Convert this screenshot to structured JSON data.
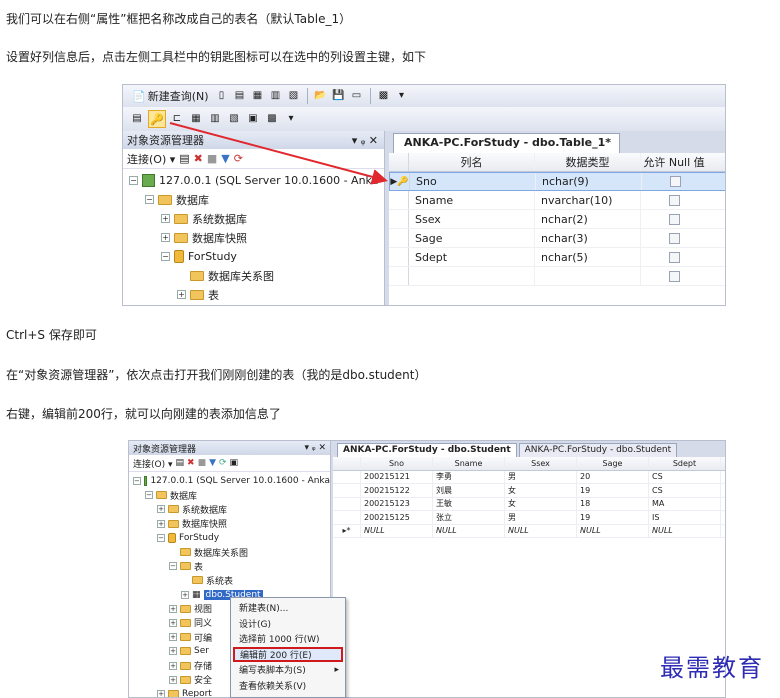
{
  "article": {
    "p1": "我们可以在右侧“属性”框把名称改成自己的表名（默认Table_1）",
    "p2": "设置好列信息后，点击左侧工具栏中的钥匙图标可以在选中的列设置主键，如下",
    "p3": "Ctrl+S 保存即可",
    "p4": "在“对象资源管理器”，依次点击打开我们刚刚创建的表（我的是dbo.student）",
    "p5": "右键，编辑前200行，就可以向刚建的表添加信息了"
  },
  "shot1": {
    "toolbar": {
      "new_query": "新建查询(N)"
    },
    "explorer": {
      "title": "对象资源管理器",
      "pin": "▾ ᵩ ✕",
      "connect": "连接(O) ▾",
      "tree": {
        "server": "127.0.0.1 (SQL Server 10.0.1600 - Anka",
        "databases": "数据库",
        "system_db": "系统数据库",
        "snapshots": "数据库快照",
        "forstudy": "ForStudy",
        "diagrams": "数据库关系图",
        "tables": "表"
      }
    },
    "designer": {
      "tab": "ANKA-PC.ForStudy - dbo.Table_1*",
      "headers": [
        "列名",
        "数据类型",
        "允许 Null 值"
      ],
      "rows": [
        {
          "name": "Sno",
          "type": "nchar(9)"
        },
        {
          "name": "Sname",
          "type": "nvarchar(10)"
        },
        {
          "name": "Ssex",
          "type": "nchar(2)"
        },
        {
          "name": "Sage",
          "type": "nchar(3)"
        },
        {
          "name": "Sdept",
          "type": "nchar(5)"
        }
      ]
    }
  },
  "shot2": {
    "explorer": {
      "title": "对象资源管理器",
      "pin": "▾ ᵩ ✕",
      "connect": "连接(O) ▾",
      "tree": {
        "server": "127.0.0.1 (SQL Server 10.0.1600 - Anka",
        "databases": "数据库",
        "system_db": "系统数据库",
        "snapshots": "数据库快照",
        "forstudy": "ForStudy",
        "diagrams": "数据库关系图",
        "tables": "表",
        "system_tables": "系统表",
        "student": "dbo.Student",
        "views": "视图",
        "synonyms": "同义",
        "programmability": "可编",
        "service": "Ser",
        "storage": "存储",
        "security": "安全",
        "reports": "Report"
      }
    },
    "tabs": [
      "ANKA-PC.ForStudy - dbo.Student",
      "ANKA-PC.ForStudy - dbo.Student"
    ],
    "grid": {
      "headers": [
        "Sno",
        "Sname",
        "Ssex",
        "Sage",
        "Sdept"
      ],
      "rows": [
        [
          "200215121",
          "李勇",
          "男",
          "20",
          "CS"
        ],
        [
          "200215122",
          "刘晨",
          "女",
          "19",
          "CS"
        ],
        [
          "200215123",
          "王敏",
          "女",
          "18",
          "MA"
        ],
        [
          "200215125",
          "张立",
          "男",
          "19",
          "IS"
        ],
        [
          "NULL",
          "NULL",
          "NULL",
          "NULL",
          "NULL"
        ]
      ],
      "new_row_marker": "▸*"
    },
    "context_menu": {
      "items": [
        "新建表(N)...",
        "设计(G)",
        "选择前 1000 行(W)",
        "编辑前 200 行(E)",
        "编写表脚本为(S)",
        "查看依赖关系(V)"
      ]
    }
  },
  "watermark": "最需教育",
  "colors": {
    "arrow": "#e0282e",
    "highlight_box": "#d0191c",
    "brand": "#2e2bb4"
  }
}
